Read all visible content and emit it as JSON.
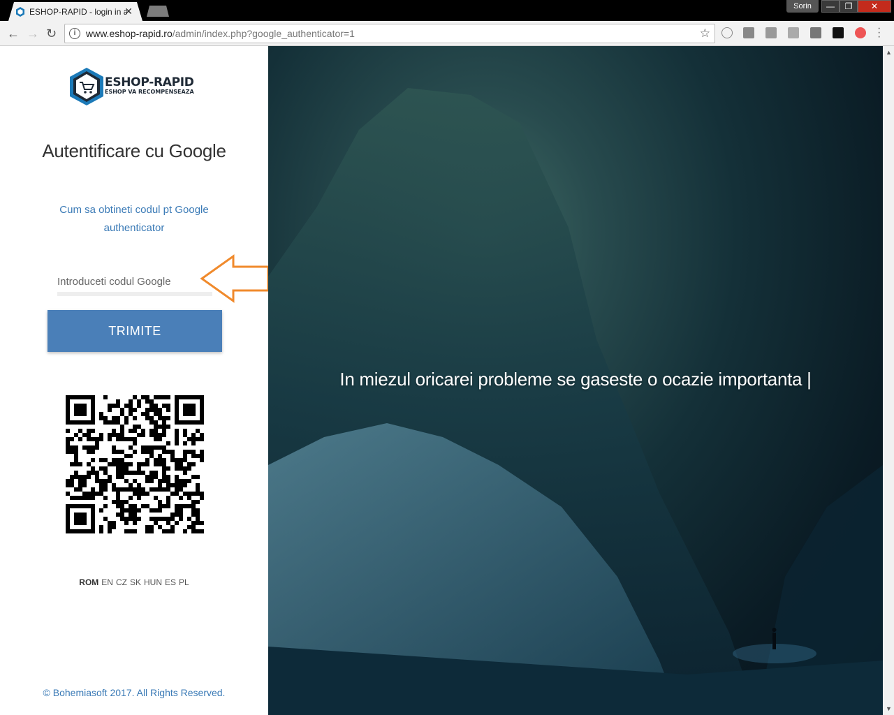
{
  "browser": {
    "tab_title": "ESHOP-RAPID - login in a",
    "tab_close": "✕",
    "user_name": "Sorin",
    "url_host": "www.eshop-rapid.ro",
    "url_path": "/admin/index.php?google_authenticator=1",
    "win_min": "—",
    "win_max": "❐",
    "win_close": "✕"
  },
  "login": {
    "brand": "ESHOP-RAPID",
    "brand_tagline": "ESHOP VA RECOMPENSEAZA",
    "heading": "Autentificare cu Google",
    "help_link": "Cum sa obtineti codul pt Google authenticator",
    "code_placeholder": "Introduceti codul Google",
    "submit_label": "TRIMITE",
    "languages": [
      {
        "label": "ROM",
        "active": true
      },
      {
        "label": "EN",
        "active": false
      },
      {
        "label": "CZ",
        "active": false
      },
      {
        "label": "SK",
        "active": false
      },
      {
        "label": "HUN",
        "active": false
      },
      {
        "label": "ES",
        "active": false
      },
      {
        "label": "PL",
        "active": false
      }
    ],
    "footer": "© Bohemiasoft 2017. All Rights Reserved."
  },
  "hero": {
    "quote": "In miezul oricarei probleme se gaseste o ocazie importanta |"
  },
  "colors": {
    "accent_button": "#4a7fb8",
    "link": "#3a7ab6",
    "arrow": "#f08a2c"
  }
}
